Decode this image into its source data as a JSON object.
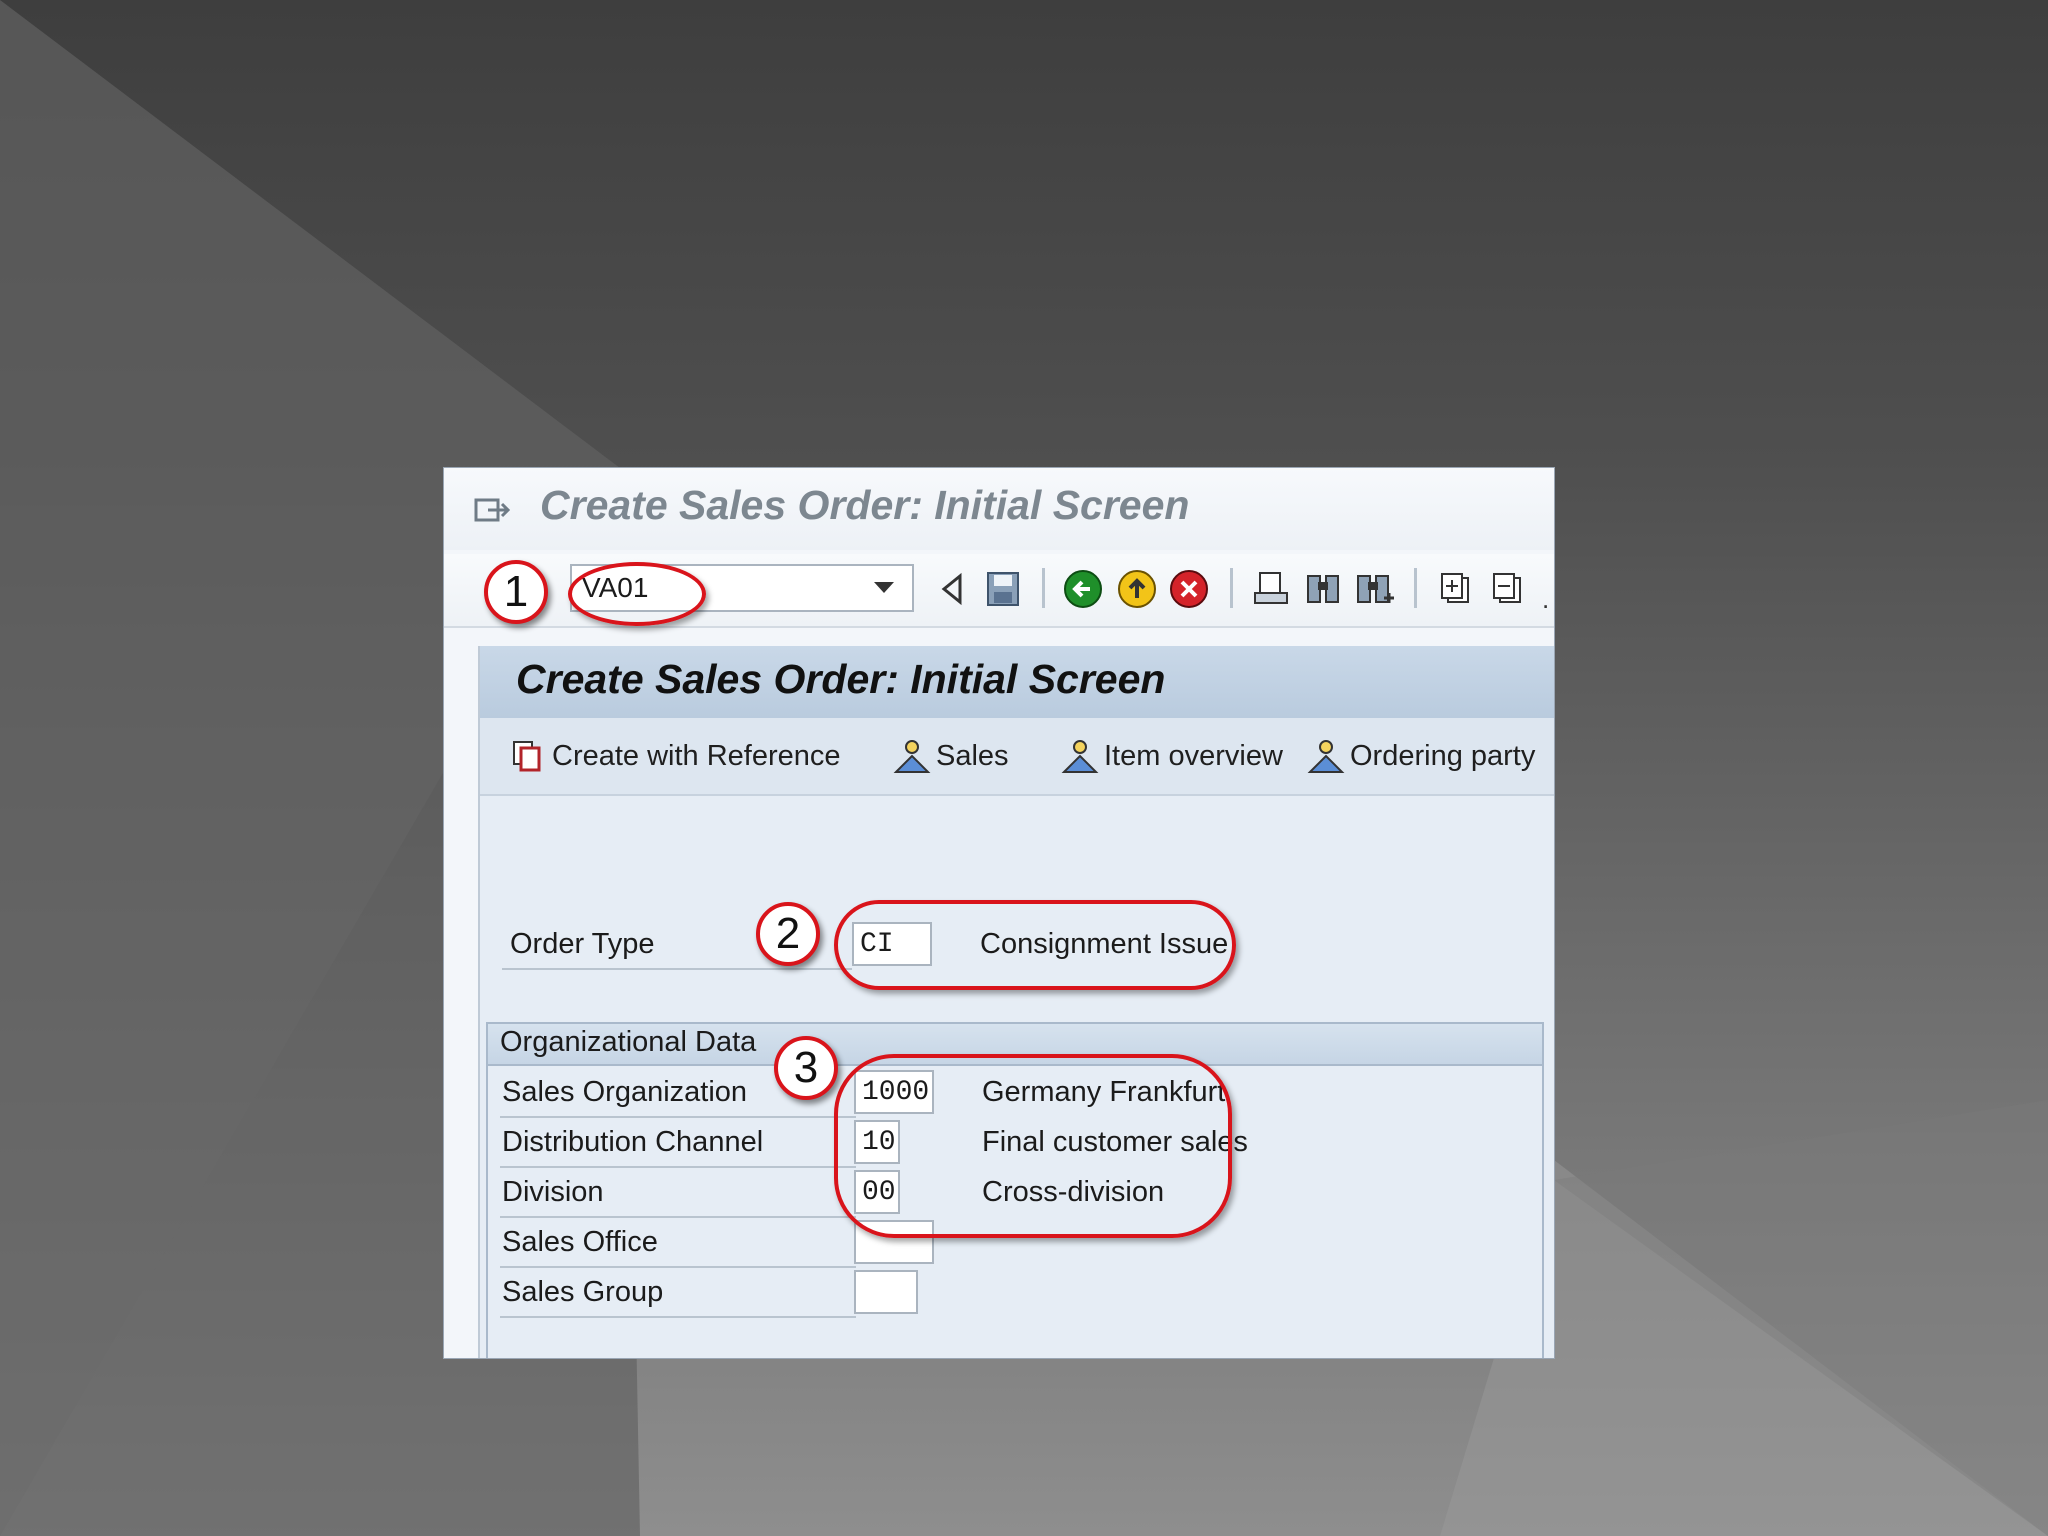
{
  "window": {
    "title": "Create Sales Order: Initial Screen"
  },
  "toolbar": {
    "command_value": "VA01",
    "icons": [
      "back-triangle-icon",
      "save-icon",
      "green-back-icon",
      "exit-icon",
      "cancel-icon",
      "print-icon",
      "find-icon",
      "find-next-icon",
      "first-page-icon",
      "previous-page-icon"
    ]
  },
  "app": {
    "title": "Create Sales Order: Initial Screen",
    "buttons": [
      {
        "label": "Create with Reference",
        "icon": "copy-icon"
      },
      {
        "label": "Sales",
        "icon": "person-icon"
      },
      {
        "label": "Item overview",
        "icon": "person-icon"
      },
      {
        "label": "Ordering party",
        "icon": "person-icon"
      }
    ]
  },
  "order_type": {
    "label": "Order Type",
    "value": "CI",
    "description": "Consignment Issue"
  },
  "org_data": {
    "title": "Organizational Data",
    "fields": [
      {
        "label": "Sales Organization",
        "value": "1000",
        "description": "Germany Frankfurt"
      },
      {
        "label": "Distribution Channel",
        "value": "10",
        "description": "Final customer sales"
      },
      {
        "label": "Division",
        "value": "00",
        "description": "Cross-division"
      },
      {
        "label": "Sales Office",
        "value": "",
        "description": ""
      },
      {
        "label": "Sales Group",
        "value": "",
        "description": ""
      }
    ]
  },
  "annotations": {
    "step1": "1",
    "step2": "2",
    "step3": "3",
    "color": "#d9141b"
  }
}
